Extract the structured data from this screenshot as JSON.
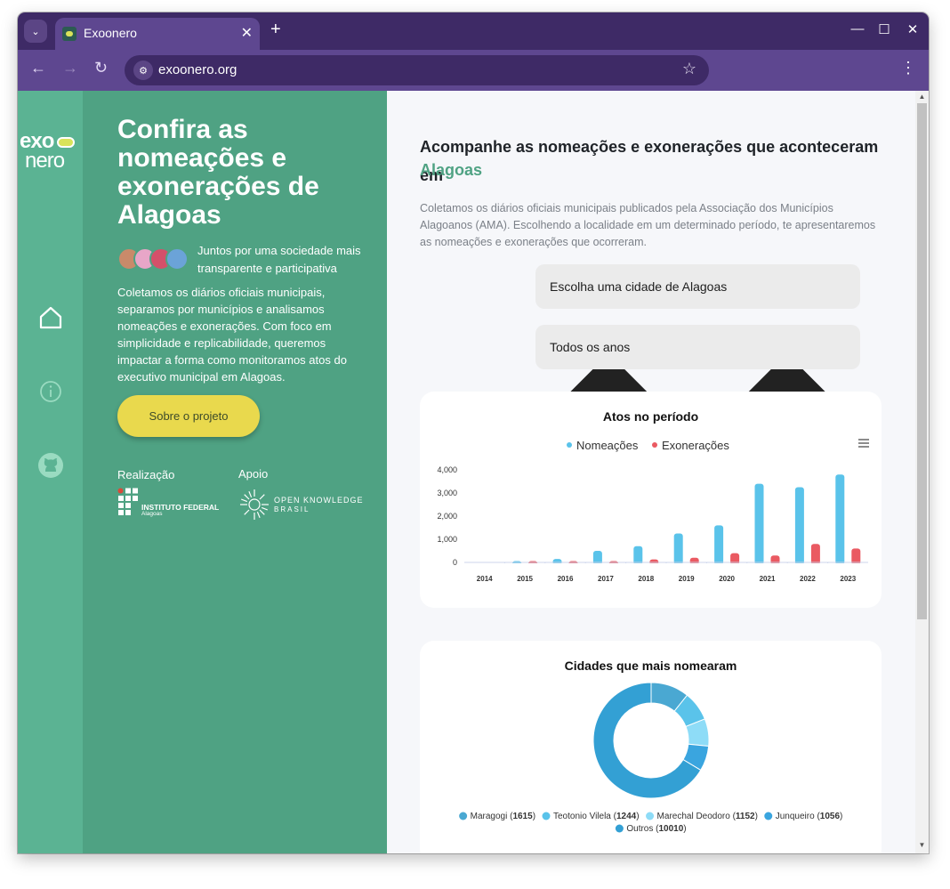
{
  "browser": {
    "tab_title": "Exoonero",
    "url": "exoonero.org",
    "new_tab_label": "+",
    "close_tab_label": "✕"
  },
  "logo": {
    "line1": "exo",
    "line2": "nero"
  },
  "hero": {
    "title": "Confira as nomeações e exonerações de Alagoas",
    "tagline": "Juntos por uma sociedade mais transparente e participativa",
    "description": "Coletamos os diários oficiais municipais, separamos por municípios e analisamos nomeações e exonerações. Com foco em simplicidade e replicabilidade, queremos impactar a forma como monitoramos atos do executivo municipal em Alagoas.",
    "about_button": "Sobre o projeto",
    "realizacao_label": "Realização",
    "apoio_label": "Apoio",
    "ifal_name": "INSTITUTO FEDERAL",
    "ifal_sub": "Alagoas",
    "okb_line1": "OPEN KNOWLEDGE",
    "okb_line2": "BRASIL"
  },
  "main": {
    "title": "Acompanhe as nomeações e exonerações que aconteceram em",
    "city": "Alagoas",
    "description": "Coletamos os diários oficiais municipais publicados pela Associação dos Municípios Alagoanos (AMA). Escolhendo a localidade em um determinado período, te apresentaremos as nomeações e exonerações que ocorreram.",
    "city_select": "Escolha uma cidade de Alagoas",
    "year_select": "Todos os anos"
  },
  "colors": {
    "rail": "#5bb393",
    "hero": "#4fa283",
    "accent_yellow": "#e9d94d",
    "nomeacoes": "#5ac3ea",
    "exoneracoes": "#ea5a62"
  },
  "chart_data": [
    {
      "type": "bar",
      "title": "Atos no período",
      "legend_position": "top",
      "categories": [
        "2014",
        "2015",
        "2016",
        "2017",
        "2018",
        "2019",
        "2020",
        "2021",
        "2022",
        "2023"
      ],
      "series": [
        {
          "name": "Nomeações",
          "values": [
            0,
            20,
            150,
            500,
            700,
            1250,
            1600,
            3400,
            3250,
            3800
          ]
        },
        {
          "name": "Exonerações",
          "values": [
            0,
            10,
            50,
            50,
            130,
            200,
            400,
            300,
            800,
            600
          ]
        }
      ],
      "ylim": [
        0,
        4000
      ],
      "yticks": [
        "0",
        "1,000",
        "2,000",
        "3,000",
        "4,000"
      ],
      "grid": false
    },
    {
      "type": "pie",
      "title": "Cidades que mais nomearam",
      "donut": true,
      "legend_position": "bottom",
      "slices": [
        {
          "name": "Maragogi",
          "value": 1615,
          "color": "#4aa8d2"
        },
        {
          "name": "Teotonio Vilela",
          "value": 1244,
          "color": "#5ac3ea"
        },
        {
          "name": "Marechal Deodoro",
          "value": 1152,
          "color": "#8edcf7"
        },
        {
          "name": "Junqueiro",
          "value": 1056,
          "color": "#3aa5df"
        },
        {
          "name": "Outros",
          "value": 10010,
          "color": "#33a0d4"
        }
      ]
    }
  ]
}
